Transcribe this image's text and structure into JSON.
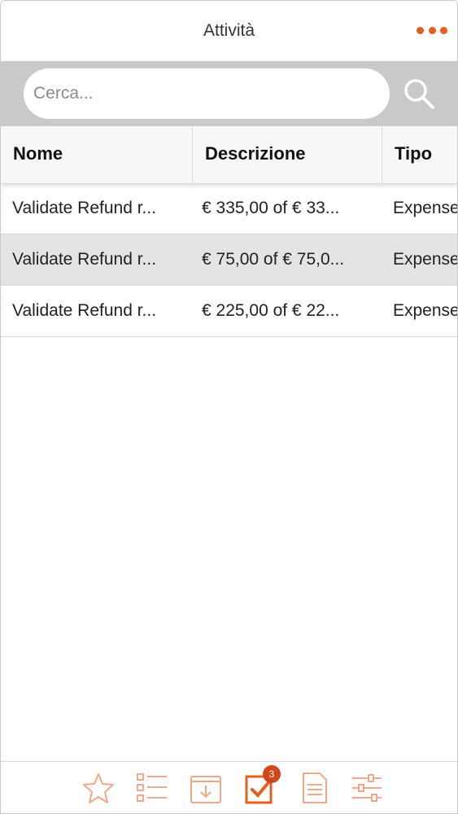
{
  "header": {
    "title": "Attività",
    "more_icon": "more-horizontal-icon"
  },
  "search": {
    "placeholder": "Cerca...",
    "value": "",
    "icon": "search-icon"
  },
  "table": {
    "columns": [
      "Nome",
      "Descrizione",
      "Tipo"
    ],
    "rows": [
      {
        "nome": "Validate Refund r...",
        "descrizione": "€ 335,00 of € 33...",
        "tipo": "Expense"
      },
      {
        "nome": "Validate Refund r...",
        "descrizione": "€ 75,00 of € 75,0...",
        "tipo": "Expense"
      },
      {
        "nome": "Validate Refund r...",
        "descrizione": "€ 225,00 of € 22...",
        "tipo": "Expense"
      }
    ],
    "selected_row": 1
  },
  "tabbar": {
    "items": [
      {
        "icon": "star-icon"
      },
      {
        "icon": "list-icon"
      },
      {
        "icon": "inbox-download-icon"
      },
      {
        "icon": "checklist-icon",
        "badge": "3",
        "active": true
      },
      {
        "icon": "document-icon"
      },
      {
        "icon": "sliders-icon"
      }
    ]
  },
  "colors": {
    "accent": "#e35f1b",
    "badge": "#d2471a",
    "searchbar_bg": "#c9c9c9",
    "selected_row": "#e4e4e4"
  }
}
